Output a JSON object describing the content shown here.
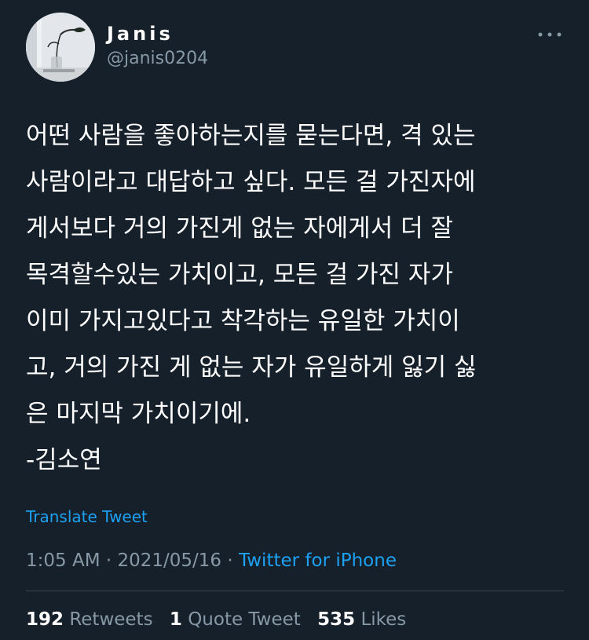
{
  "author": {
    "display_name": "Janis",
    "handle": "@janis0204",
    "avatar_icon": "avatar-photo-plant-vase"
  },
  "menu": {
    "icon": "more-horizontal-icon"
  },
  "tweet": {
    "lines": [
      "어떤 사람을 좋아하는지를 묻는다면, 격 있는",
      "사람이라고 대답하고 싶다. 모든 걸 가진자에",
      "게서보다 거의 가진게 없는 자에게서 더 잘",
      "목격할수있는 가치이고, 모든 걸 가진 자가",
      "이미 가지고있다고 착각하는 유일한 가치이",
      "고, 거의 가진 게 없는 자가 유일하게 잃기 싫",
      "은 마지막 가치이기에.",
      "-김소연"
    ]
  },
  "translate_label": "Translate Tweet",
  "meta": {
    "time": "1:05 AM",
    "separator": " · ",
    "date": "2021/05/16",
    "source": "Twitter for iPhone"
  },
  "stats": {
    "retweets_count": "192",
    "retweets_label": "Retweets",
    "quotes_count": "1",
    "quotes_label": "Quote Tweet",
    "likes_count": "535",
    "likes_label": "Likes"
  },
  "colors": {
    "background": "#15202b",
    "accent": "#1da1f2",
    "secondary_text": "#8899a6",
    "divider": "#38444d"
  }
}
